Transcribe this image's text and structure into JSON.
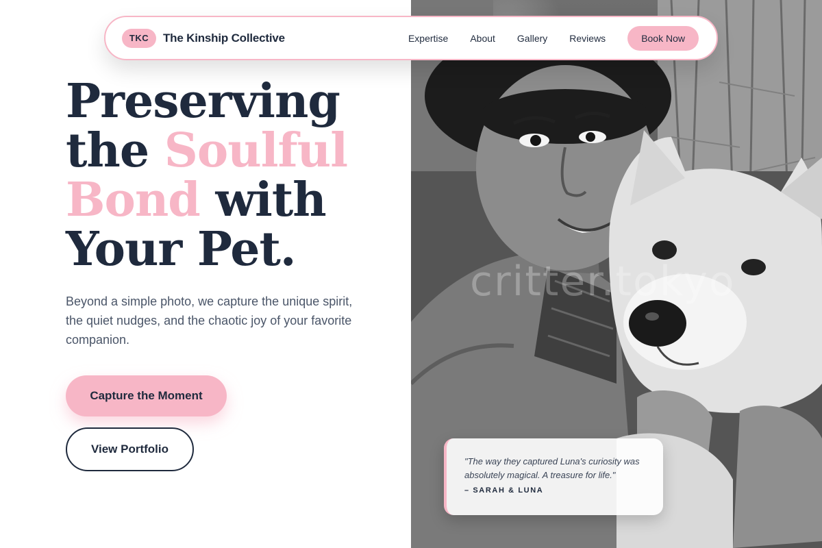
{
  "nav": {
    "brand_badge": "TKC",
    "brand_name": "The Kinship Collective",
    "links": [
      "Expertise",
      "About",
      "Gallery",
      "Reviews"
    ],
    "cta": "Book Now"
  },
  "hero": {
    "headline": {
      "line1": "Preserving",
      "line2_plain": "the ",
      "line2_accent": "Soulful",
      "line3_accent": "Bond",
      "line3_plain": " with",
      "line4": "Your Pet."
    },
    "subtitle": "Beyond a simple photo, we capture the unique spirit, the quiet nudges, and the chaotic joy of your favorite companion.",
    "primary_button": "Capture the Moment",
    "secondary_button": "View Portfolio"
  },
  "photo": {
    "watermark": "critter.tokyo"
  },
  "testimonial": {
    "quote": "\"The way they captured Luna's curiosity was absolutely magical. A treasure for life.\"",
    "author": "– SARAH & LUNA"
  },
  "colors": {
    "accent_pink": "#f7b6c6",
    "navy": "#1f2a3d",
    "body_text": "#4a5568"
  }
}
